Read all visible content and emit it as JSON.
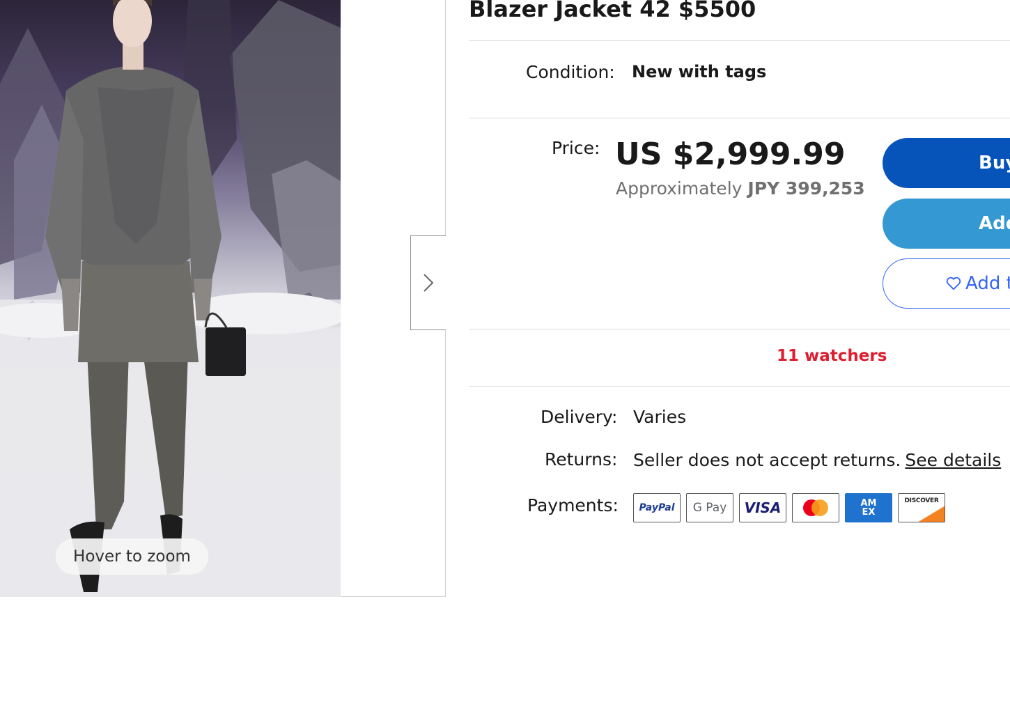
{
  "gallery": {
    "zoom_hint": "Hover to zoom"
  },
  "listing": {
    "title": "Blazer Jacket 42 $5500",
    "condition_label": "Condition:",
    "condition_value": "New with tags",
    "price_label": "Price:",
    "price": "US $2,999.99",
    "approx_prefix": "Approximately",
    "approx_value": "JPY 399,253",
    "watchers": "11 watchers"
  },
  "actions": {
    "buy_label": "Buy",
    "cart_label": "Add",
    "watch_label": "Add t"
  },
  "shipping": {
    "delivery_label": "Delivery:",
    "delivery_value": "Varies",
    "returns_label": "Returns:",
    "returns_value": "Seller does not accept returns.",
    "returns_link": "See details",
    "payments_label": "Payments:"
  },
  "payment_methods": {
    "paypal": "PayPal",
    "gpay": "G Pay",
    "visa": "VISA",
    "amex": "AM EX",
    "discover": "DISCOVER"
  },
  "colors": {
    "buy_button": "#0654ba",
    "cart_button": "#3498d3",
    "watch_button": "#3665f3",
    "watchers_text": "#dd1e31"
  }
}
